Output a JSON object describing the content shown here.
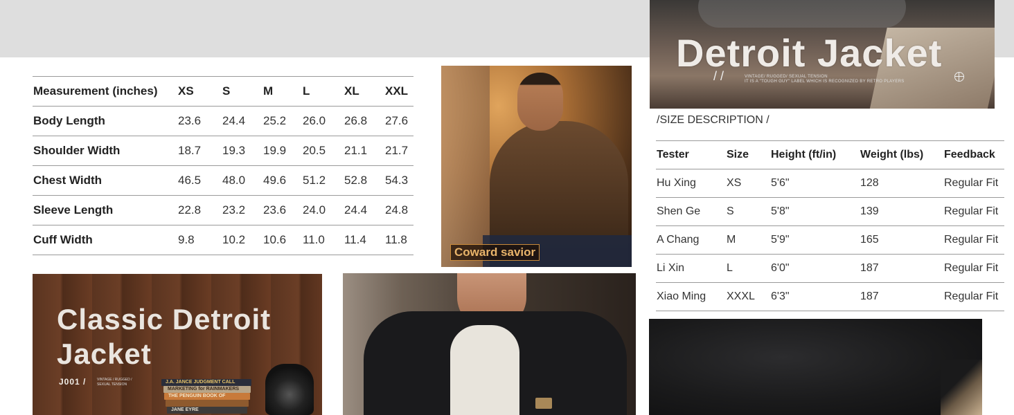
{
  "measurement_table": {
    "headers": [
      "Measurement (inches)",
      "XS",
      "S",
      "M",
      "L",
      "XL",
      "XXL"
    ],
    "rows": [
      {
        "label": "Body Length",
        "values": [
          "23.6",
          "24.4",
          "25.2",
          "26.0",
          "26.8",
          "27.6"
        ]
      },
      {
        "label": "Shoulder Width",
        "values": [
          "18.7",
          "19.3",
          "19.9",
          "20.5",
          "21.1",
          "21.7"
        ]
      },
      {
        "label": "Chest Width",
        "values": [
          "46.5",
          "48.0",
          "49.6",
          "51.2",
          "52.8",
          "54.3"
        ]
      },
      {
        "label": "Sleeve Length",
        "values": [
          "22.8",
          "23.2",
          "23.6",
          "24.0",
          "24.4",
          "24.8"
        ]
      },
      {
        "label": "Cuff Width",
        "values": [
          "9.8",
          "10.2",
          "10.6",
          "11.0",
          "11.4",
          "11.8"
        ]
      }
    ]
  },
  "banner": {
    "title": "Detroit Jacket",
    "slash": "/ /",
    "subtitle_line1": "VINTAGE/ RUGGED/ SEXUAL TENSION",
    "subtitle_line2": "IT IS A \"TOUGH GUY\" LABEL WHICH IS RECOGNIZED BY RETRO PLAYERS",
    "icon": "globe-icon"
  },
  "size_description": {
    "title": "/SIZE DESCRIPTION /",
    "headers": [
      "Tester",
      "Size",
      "Height (ft/in)",
      "Weight (lbs)",
      "Feedback"
    ],
    "rows": [
      [
        "Hu Xing",
        "XS",
        "5'6\"",
        "128",
        "Regular Fit"
      ],
      [
        "Shen Ge",
        "S",
        "5'8\"",
        "139",
        "Regular Fit"
      ],
      [
        "A Chang",
        "M",
        "5'9\"",
        "165",
        "Regular Fit"
      ],
      [
        "Li Xin",
        "L",
        "6'0\"",
        "187",
        "Regular Fit"
      ],
      [
        "Xiao Ming",
        "XXXL",
        "6'3\"",
        "187",
        "Regular Fit"
      ]
    ]
  },
  "savior_photo": {
    "label": "Coward savior"
  },
  "classic_photo": {
    "title_line1": "Classic Detroit",
    "title_line2": "Jacket",
    "code": "J001 /",
    "sub_line1": "VINTAGE / RUGGED /",
    "sub_line2": "SEXUAL TENSION",
    "books": [
      "J.A. JANCE JUDGMENT CALL",
      "MARKETING for RAINMAKERS",
      "THE PENGUIN BOOK OF",
      "",
      "JANE EYRE"
    ]
  }
}
